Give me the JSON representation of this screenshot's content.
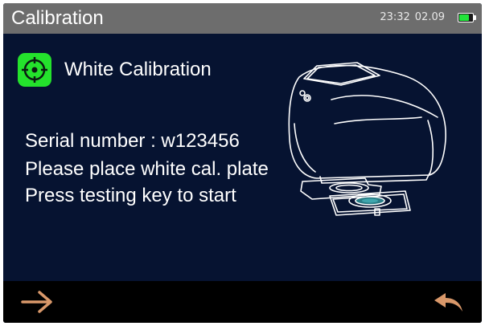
{
  "header": {
    "title": "Calibration",
    "time": "23:32",
    "date": "02.09",
    "battery_level": 0.85
  },
  "content": {
    "heading": "White Calibration",
    "heading_icon": "target-icon",
    "lines": [
      "Serial number : w123456",
      "Please place white cal. plate",
      "Press testing key to start"
    ],
    "illustration": "colorimeter-on-calibration-plate"
  },
  "footer": {
    "next_icon": "arrow-right-icon",
    "back_icon": "return-arrow-icon"
  },
  "colors": {
    "background": "#061331",
    "header": "#6d6d6d",
    "accent_green": "#24e22c",
    "nav_arrow": "#d9986a"
  }
}
